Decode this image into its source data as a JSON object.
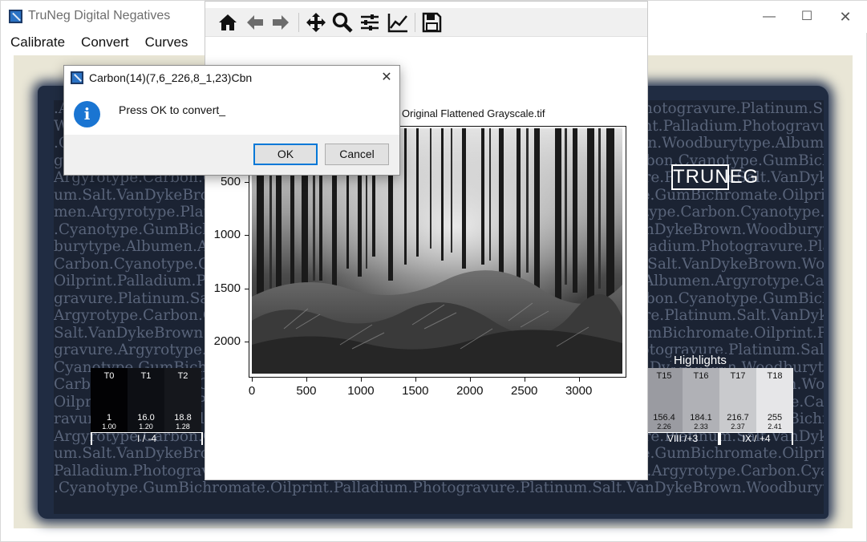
{
  "window": {
    "title": "TruNeg Digital Negatives",
    "minimize": "—",
    "maximize": "☐",
    "close": "✕"
  },
  "menu": [
    "Calibrate",
    "Convert",
    "Curves"
  ],
  "background": {
    "text_lines": [
      ".Albumen.Argyrotype.Carbon.Cyanotype.GumBichromate.Oilprint.Palladium.Photogravure.Platinum.Salt.VanDykeBrown.Woodburytype",
      "Woodburytype.Albumen.Argyrotype.Carbon.Cyanotype.GumBichromate.Oilprint.Palladium.Photogravure.Platinum.Salt.VanDykeBrown.Woodburytype",
      ".GumBichromate.Oilprint.Palladium.Photogravure.Platinum.Salt.VanDykeBrown.Woodburytype.Albumen.Argyrotype.Carbon",
      "gravure.Platinum.Salt.VanDykeBrown.Woodburytype.Albumen.Argyrotype.Carbon.Cyanotype.GumBichromate.Oilprint.Palladium.Phot",
      "Argyrotype.Carbon.Cyanotype.GumBichromate.Oilprint.Palladium.Photogravure.Platinum.Salt.VanDykeBrown.Woodburytype.Albumen",
      "um.Salt.VanDykeBrown.Woodburytype.Albumen.Argyrotype.Carbon.Cyanotype.GumBichromate.Oilprint.Palladium.Photogravure.Platin",
      "men.Argyrotype.Platinum.Salt.VanDykeBrown.Woodburytype.Albumen.Argyrotype.Carbon.Cyanotype.GumBichromate.Oilprint.Photo",
      ".Cyanotype.GumBichromate.Oilprint.Palladium.Photogravure.Platinum.Salt.VanDykeBrown.Woodburytype.Albumen.Argyrotype.Carbon",
      "burytype.Albumen.Argyrotype.Carbon.Cyanotype.GumBichromate.Oilprint.Palladium.Photogravure.Platinum.Salt.VanDykeBrown.Woodb",
      "Carbon.Cyanotype.GumBichromate.Oilprint.Palladium.Photogravure.Platinum.Salt.VanDykeBrown.Woodburytype.Albumen.Argyrotype",
      "Oilprint.Palladium.Photogravure.Platinum.Salt.VanDykeBrown.Woodburytype.Albumen.Argyrotype.Carbon.Cyanotype.GumBichromate",
      "gravure.Platinum.Salt.VanDykeBrown.Woodburytype.Albumen.Argyrotype.Carbon.Cyanotype.GumBichromate.Oilprint.Palladium.Photo",
      "Argyrotype.Carbon.Cyanotype.GumBichromate.Oilprint.Palladium.Photogravure.Platinum.Salt.VanDykeBrown.Woodburytype.Albumen",
      "Salt.VanDykeBrown.Woodburytype.Albumen.Argyrotype.Carbon.Cyanotype.GumBichromate.Oilprint.Palladium.Photogravure.Platinum",
      "gravure.Argyrotype.Carbon.Cyanotype.GumBichromate.Oilprint.Palladium.Photogravure.Platinum.Salt.VanDykeBrown.Woodburytype",
      "Cyanotype.GumBichromate.Oilprint.Palladium.Photogravure.Platinum.Salt.VanDykeBrown.Woodburytype.Albumen.Argyrotype.Carbon",
      "Carbon.Cyanotype.GumBichromate.Oilprint.Palladium.Photogravure.Platinum.Salt.VanDykeBrown.Woodburytype.Albumen.Argyrotype",
      "Oilprint.Palladium.Photogravure.Platinum.Salt.VanDykeBrown.Woodburytype.Albumen.Argyrotype.Carbon.Cyanotype.GumBichromate",
      "ravure.Platinum.Salt.VanDykeBrown.Woodburytype.Albumen.Argyrotype.Carbon.Cyanotype.GumBichromate.Oilprint.Palladium.Photo",
      "Argyrotype.Carbon.Cyanotype.GumBichromate.Oilprint.Palladium.Photogravure.Platinum.Salt.VanDykeBrown.Woodburytype.Albumen",
      "um.Salt.VanDykeBrown.Woodburytype.Albumen.Argyrotype.Carbon.Cyanotype.GumBichromate.Oilprint.Palladium.Photogravure.Platinu",
      "Palladium.Photogravure.Platinum.Salt.VanDykeBrown.Woodburytype.Albumen.Argyrotype.Carbon.Cyanotype.GumBichromate.Oilprint",
      ".Cyanotype.GumBichromate.Oilprint.Palladium.Photogravure.Platinum.Salt.VanDykeBrown.Woodburytype.Albumen.Argyrotype.Carbon"
    ],
    "logo": "TRUNEG",
    "highlights_label": "Highlights",
    "left_steps": [
      {
        "name": "T0",
        "value": "1",
        "density": "1.00"
      },
      {
        "name": "T1",
        "value": "16.0",
        "density": "1.20"
      },
      {
        "name": "T2",
        "value": "18.8",
        "density": "1.28"
      }
    ],
    "right_steps": [
      {
        "name": "T15",
        "value": "156.4",
        "density": "2.26"
      },
      {
        "name": "T16",
        "value": "184.1",
        "density": "2.33"
      },
      {
        "name": "T17",
        "value": "216.7",
        "density": "2.37"
      },
      {
        "name": "T18",
        "value": "255",
        "density": "2.41"
      }
    ],
    "left_zones": [
      "I / -4"
    ],
    "right_zones": [
      "VIII /+3",
      "IX / +4"
    ]
  },
  "plot_window": {
    "toolbar": [
      {
        "name": "home",
        "icon": "home-icon"
      },
      {
        "name": "back",
        "icon": "arrow-left-icon"
      },
      {
        "name": "forward",
        "icon": "arrow-right-icon"
      },
      {
        "name": "pan",
        "icon": "move-icon"
      },
      {
        "name": "zoom",
        "icon": "magnifier-icon"
      },
      {
        "name": "configure",
        "icon": "sliders-icon"
      },
      {
        "name": "edit-curve",
        "icon": "line-chart-icon"
      },
      {
        "name": "save",
        "icon": "floppy-disk-icon"
      }
    ],
    "plot_title": "Original Flattened Grayscale.tif",
    "x_ticks": [
      "0",
      "500",
      "1000",
      "1500",
      "2000",
      "2500",
      "3000"
    ],
    "y_ticks": [
      "500",
      "1000",
      "1500",
      "2000"
    ],
    "image_description_icon": "forest-photo"
  },
  "dialog": {
    "title": "Carbon(14)(7,6_226,8_1,23)Cbn",
    "close": "✕",
    "info_icon": "i",
    "message": "Press OK to convert_",
    "ok_label": "OK",
    "cancel_label": "Cancel"
  },
  "colors": {
    "accent": "#0078d7",
    "info": "#1a75d2",
    "paper": "#e9e6d6",
    "cyanotype": "#202c42"
  }
}
